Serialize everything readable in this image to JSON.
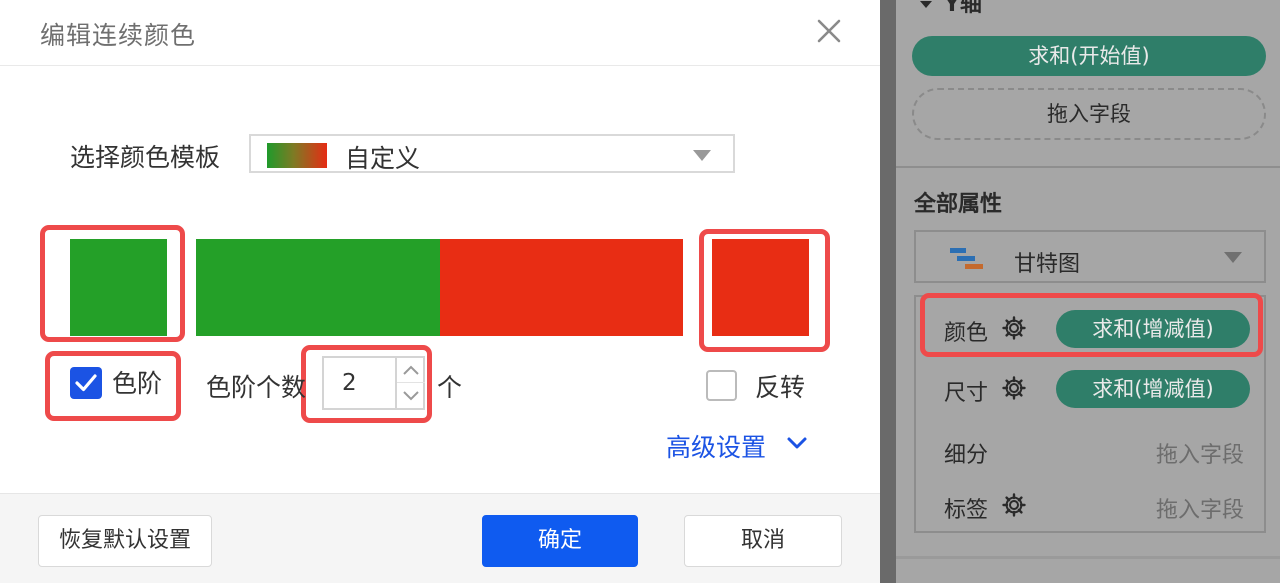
{
  "dialog": {
    "title": "编辑连续颜色",
    "template_label": "选择颜色模板",
    "template_value": "自定义",
    "start_color": "#24a028",
    "end_color": "#e82d14",
    "gradient_steps": [
      "#24a028",
      "#e82d14"
    ],
    "step_checkbox_label": "色阶",
    "step_checkbox_checked": true,
    "step_count_label": "色阶个数",
    "step_count_value": "2",
    "step_count_unit": "个",
    "reverse_label": "反转",
    "reverse_checked": false,
    "advanced_label": "高级设置",
    "reset_button": "恢复默认设置",
    "ok_button": "确定",
    "cancel_button": "取消"
  },
  "panel": {
    "axis_title": "Y轴",
    "axis_field": "求和(开始值)",
    "axis_dropzone": "拖入字段",
    "props_title": "全部属性",
    "chart_type": "甘特图",
    "rows": [
      {
        "label": "颜色",
        "value": "求和(增减值)"
      },
      {
        "label": "尺寸",
        "value": "求和(增减值)"
      },
      {
        "label": "细分",
        "value": "拖入字段"
      },
      {
        "label": "标签",
        "value": "拖入字段"
      }
    ]
  },
  "colors": {
    "accent": "#1b53e4",
    "primary_button": "#0f5bf0",
    "highlight": "#ee4a4a",
    "pill": "#2f7e69",
    "overlay_panel": "#a6a6a6"
  }
}
